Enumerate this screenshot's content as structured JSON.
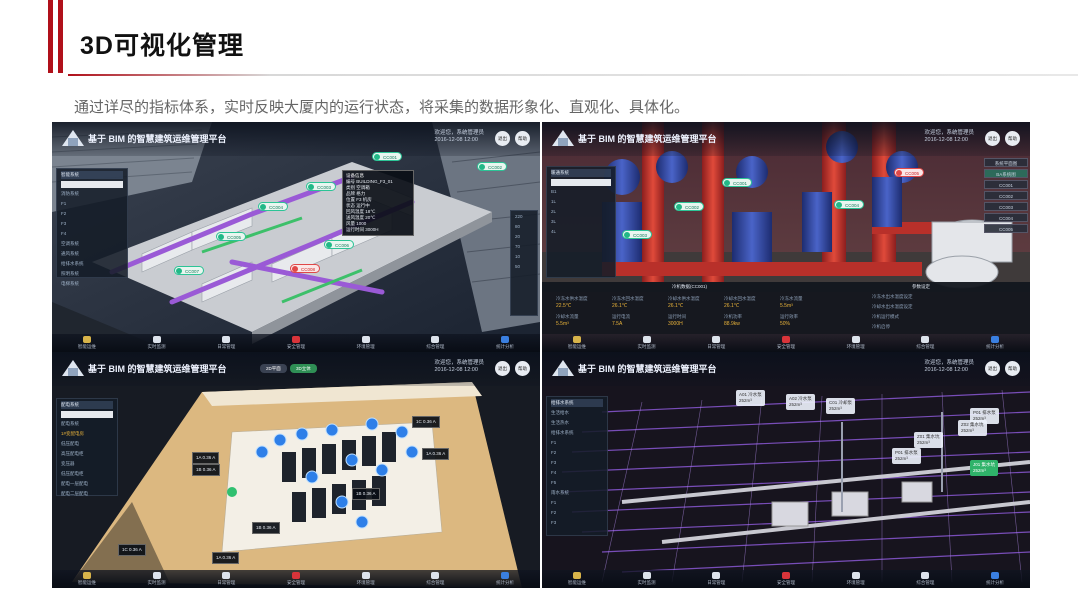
{
  "page": {
    "title": "3D可视化管理",
    "subtitle": "通过详尽的指标体系，实时反映大厦内的运行状态，将采集的数据形象化、直观化、具体化。",
    "colors": {
      "accent": "#b0101a",
      "tag_green": "#22b887",
      "tag_red": "#e04848",
      "metric_amber": "#e8b23a"
    }
  },
  "app": {
    "title": "基于 BIM 的智慧建筑运维管理平台",
    "welcome": "欢迎您，系统管理员",
    "datetime": "2016-12-08 12:00",
    "btn_exit": "退出",
    "btn_help": "帮助"
  },
  "nav": [
    "智能运维",
    "实时监测",
    "日常管理",
    "安全管理",
    "环境管理",
    "综合管理",
    "统计分析"
  ],
  "screen1": {
    "left_panel": {
      "head": "智能系统",
      "rows": [
        "消防系统",
        "F1",
        "F2",
        "F3",
        "F4",
        "空调系统",
        "通风系统",
        "给排水系统",
        "照明系统",
        "电梯系统"
      ]
    },
    "tags": [
      "CC001",
      "CC002",
      "CC003",
      "CC004",
      "CC005",
      "CC006",
      "CC007",
      "CC008"
    ],
    "info_box": {
      "title": "设备信息",
      "rows": [
        "编号 BUILDING_F3_01",
        "类别 空调箱",
        "品牌 格力",
        "位置 F3 机房",
        "状态 运行中",
        "回风温度 18℃",
        "送风温度 20℃",
        "风量 1000",
        "运行时间 3000H"
      ]
    },
    "right_panel": [
      "220",
      "80",
      "20",
      "70",
      "10",
      "50"
    ]
  },
  "screen2": {
    "tags": [
      "CC001",
      "CC002",
      "CC003",
      "CC004",
      "CC005",
      "CC006"
    ],
    "equipment": [
      "系统平面图",
      "BA系统图",
      "CC001",
      "CC002",
      "CC003",
      "CC004",
      "CC005"
    ],
    "dashboard_title": "冷机数据(CC001)",
    "metrics": [
      {
        "label": "冷冻水供水温度",
        "value": "22.5℃"
      },
      {
        "label": "冷冻水回水温度",
        "value": "26.1℃"
      },
      {
        "label": "冷却水供水温度",
        "value": "26.1℃"
      },
      {
        "label": "冷却水回水温度",
        "value": "26.1℃"
      },
      {
        "label": "冷冻水流量",
        "value": "5.5m³"
      },
      {
        "label": "冷却水流量",
        "value": "5.5m³"
      },
      {
        "label": "运行电流",
        "value": "7.5A"
      },
      {
        "label": "运行时间",
        "value": "3000H"
      },
      {
        "label": "冷机功率",
        "value": "88.9kw"
      },
      {
        "label": "运行效率",
        "value": "50%"
      }
    ],
    "settings_title": "参数设定",
    "settings": [
      "冷冻水出水温度设定",
      "冷却水出水温度设定",
      "冷机运行模式",
      "冷机启停"
    ]
  },
  "screen3": {
    "tabs": [
      "2D平面",
      "3D立体"
    ],
    "left_panel": {
      "head": "配电系统",
      "rows": [
        "配电系统",
        "1#变配电房",
        "低压配电",
        "高压配电柜",
        "变压器",
        "低压配电柜",
        "配电一层配电",
        "配电二层配电"
      ]
    },
    "labels": [
      "1A 0.36 A",
      "1B 0.36 A",
      "1C 0.36 A",
      "1A 0.36 A",
      "1B 0.36 A",
      "1C 0.36 A",
      "1A 0.36 A",
      "1B 0.36 A"
    ]
  },
  "screen4": {
    "left_panel": {
      "head": "给排水系统",
      "rows": [
        "生活给水",
        "生活热水",
        "给排水系统",
        "F1",
        "F2",
        "F3",
        "F4",
        "F5",
        "雨水系统",
        "F1",
        "F2",
        "F3"
      ]
    },
    "labels": [
      {
        "name": "A01 冷水泵",
        "value": "252m³"
      },
      {
        "name": "A02 冷水泵",
        "value": "252m³"
      },
      {
        "name": "C01 冷却泵",
        "value": "252m³"
      },
      {
        "name": "P01 排水泵",
        "value": "252m³"
      },
      {
        "name": "Z01 集水坑",
        "value": "252m³"
      },
      {
        "name": "Z02 集水坑",
        "value": "252m³"
      },
      {
        "name": "P01 排水泵",
        "value": "252m³"
      },
      {
        "name": "J01 集水坑",
        "value": "252m³"
      }
    ]
  }
}
